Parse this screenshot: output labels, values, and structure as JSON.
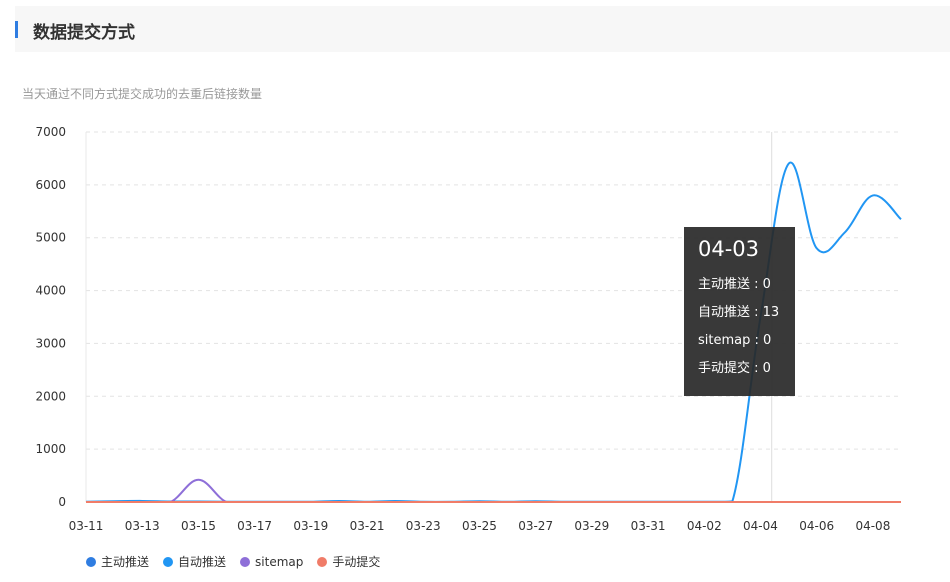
{
  "header": {
    "title": "数据提交方式"
  },
  "description": "当天通过不同方式提交成功的去重后链接数量",
  "tooltip": {
    "date": "04-03",
    "rows": [
      "主动推送 : 0",
      "自动推送 : 13",
      "sitemap : 0",
      "手动提交 : 0"
    ]
  },
  "legend": [
    {
      "label": "主动推送",
      "color": "#2f7de1"
    },
    {
      "label": "自动推送",
      "color": "#2196f3"
    },
    {
      "label": "sitemap",
      "color": "#8e6fd8"
    },
    {
      "label": "手动提交",
      "color": "#f07c68"
    }
  ],
  "chart_data": {
    "type": "line",
    "x_tick_labels": [
      "03-11",
      "03-13",
      "03-15",
      "03-17",
      "03-19",
      "03-21",
      "03-23",
      "03-25",
      "03-27",
      "03-29",
      "03-31",
      "04-02",
      "04-04",
      "04-06",
      "04-08"
    ],
    "y_tick_labels": [
      "0",
      "1000",
      "2000",
      "3000",
      "4000",
      "5000",
      "6000",
      "7000"
    ],
    "ylim": [
      0,
      7000
    ],
    "x": [
      "03-11",
      "03-12",
      "03-13",
      "03-14",
      "03-15",
      "03-16",
      "03-17",
      "03-18",
      "03-19",
      "03-20",
      "03-21",
      "03-22",
      "03-23",
      "03-24",
      "03-25",
      "03-26",
      "03-27",
      "03-28",
      "03-29",
      "03-30",
      "03-31",
      "04-01",
      "04-02",
      "04-03",
      "04-04",
      "04-05",
      "04-06",
      "04-07",
      "04-08",
      "04-09"
    ],
    "series": [
      {
        "name": "主动推送",
        "color": "#2f7de1",
        "values": [
          0,
          0,
          0,
          0,
          0,
          0,
          0,
          0,
          0,
          0,
          0,
          0,
          0,
          0,
          0,
          0,
          0,
          0,
          0,
          0,
          0,
          0,
          0,
          0,
          0,
          0,
          0,
          0,
          0,
          0
        ]
      },
      {
        "name": "自动推送",
        "color": "#2196f3",
        "values": [
          5,
          15,
          20,
          10,
          10,
          5,
          5,
          5,
          5,
          20,
          5,
          20,
          5,
          5,
          15,
          5,
          15,
          5,
          5,
          5,
          5,
          5,
          5,
          13,
          3500,
          6400,
          4800,
          5100,
          5800,
          5350
        ]
      },
      {
        "name": "sitemap",
        "color": "#8e6fd8",
        "values": [
          0,
          0,
          0,
          0,
          420,
          0,
          0,
          0,
          0,
          0,
          0,
          0,
          0,
          0,
          0,
          0,
          0,
          0,
          0,
          0,
          0,
          0,
          0,
          0,
          0,
          0,
          0,
          0,
          0,
          0
        ]
      },
      {
        "name": "手动提交",
        "color": "#f07c68",
        "values": [
          0,
          0,
          0,
          0,
          0,
          0,
          0,
          0,
          0,
          0,
          0,
          0,
          0,
          0,
          0,
          0,
          0,
          0,
          0,
          0,
          0,
          0,
          0,
          0,
          0,
          0,
          0,
          0,
          0,
          0
        ]
      }
    ],
    "grid": true,
    "hover_index": 23
  }
}
